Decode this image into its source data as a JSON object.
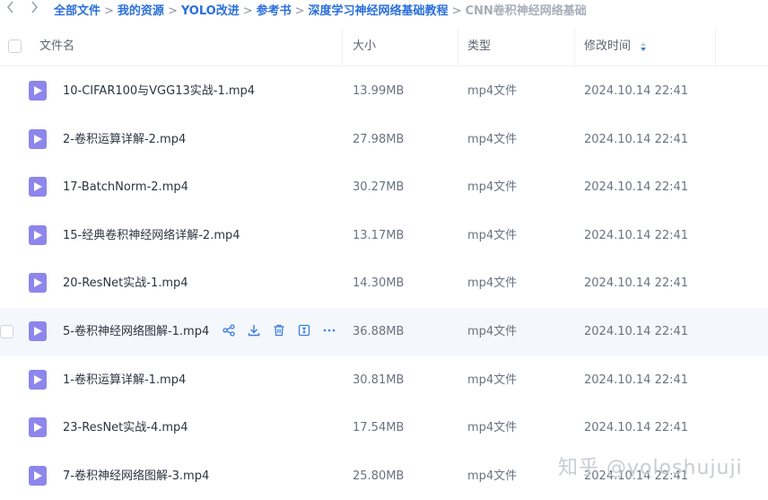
{
  "breadcrumb": {
    "items": [
      "全部文件",
      "我的资源",
      "YOLO改进",
      "参考书",
      "深度学习神经网络基础教程",
      "CNN卷积神经网络基础"
    ],
    "separator": ">"
  },
  "table": {
    "columns": {
      "name": "文件名",
      "size": "大小",
      "type": "类型",
      "modified": "修改时间"
    },
    "rows": [
      {
        "name": "10-CIFAR100与VGG13实战-1.mp4",
        "size": "13.99MB",
        "type": "mp4文件",
        "time": "2024.10.14 22:41"
      },
      {
        "name": "2-卷积运算详解-2.mp4",
        "size": "27.98MB",
        "type": "mp4文件",
        "time": "2024.10.14 22:41"
      },
      {
        "name": "17-BatchNorm-2.mp4",
        "size": "30.27MB",
        "type": "mp4文件",
        "time": "2024.10.14 22:41"
      },
      {
        "name": "15-经典卷积神经网络详解-2.mp4",
        "size": "13.17MB",
        "type": "mp4文件",
        "time": "2024.10.14 22:41"
      },
      {
        "name": "20-ResNet实战-1.mp4",
        "size": "14.30MB",
        "type": "mp4文件",
        "time": "2024.10.14 22:41"
      },
      {
        "name": "5-卷积神经网络图解-1.mp4",
        "size": "36.88MB",
        "type": "mp4文件",
        "time": "2024.10.14 22:41"
      },
      {
        "name": "1-卷积运算详解-1.mp4",
        "size": "30.81MB",
        "type": "mp4文件",
        "time": "2024.10.14 22:41"
      },
      {
        "name": "23-ResNet实战-4.mp4",
        "size": "17.54MB",
        "type": "mp4文件",
        "time": "2024.10.14 22:41"
      },
      {
        "name": "7-卷积神经网络图解-3.mp4",
        "size": "25.80MB",
        "type": "mp4文件",
        "time": "2024.10.14 22:41"
      }
    ]
  },
  "hover_row_index": 5,
  "row_actions": [
    "share-icon",
    "download-icon",
    "delete-icon",
    "rename-icon",
    "more-icon"
  ],
  "watermark": "知乎 @yoloshujuji",
  "colors": {
    "link": "#2a6fdb",
    "file_icon": "#8d86ec",
    "action_icon": "#3b7ce0",
    "hover_bg": "#f4f7fc"
  }
}
